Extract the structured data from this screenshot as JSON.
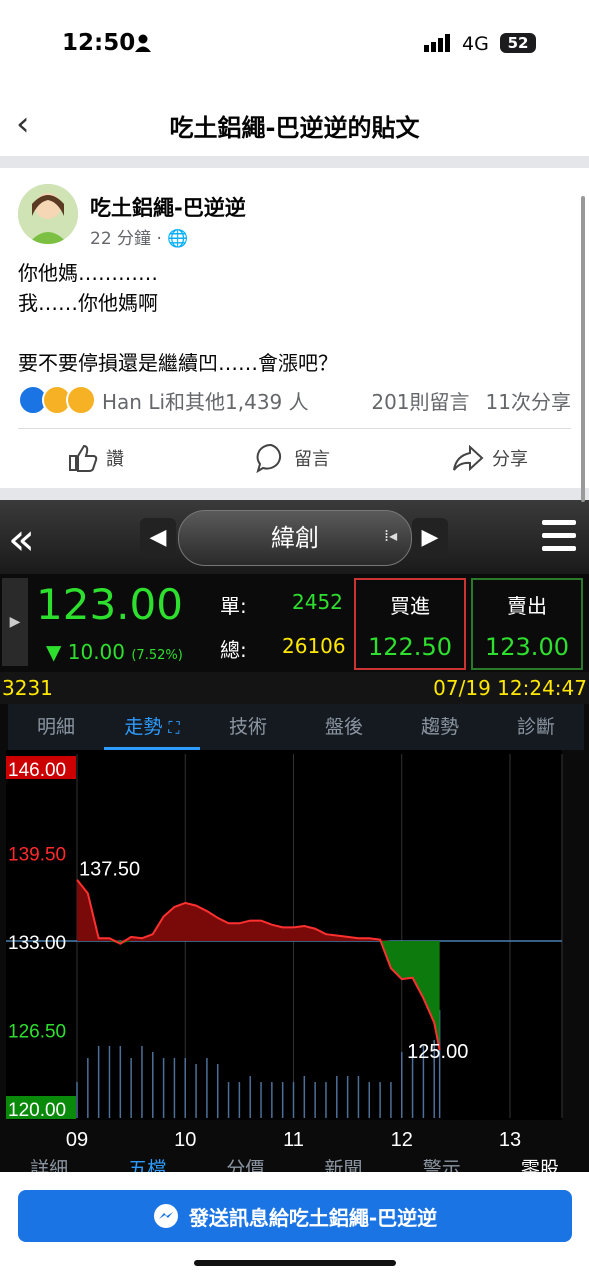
{
  "status_bar": {
    "time": "12:50",
    "network": "4G",
    "battery": "52"
  },
  "header": {
    "title": "吃土鋁繩-巴逆逆的貼文"
  },
  "post": {
    "author": "吃土鋁繩-巴逆逆",
    "time": "22 分鐘",
    "lines": [
      "你他媽…………",
      "我……你他媽啊",
      "",
      "要不要停損還是繼續凹……會漲吧？"
    ],
    "reaction_names": "Han Li和其他1,439 人",
    "comments": "201則留言",
    "shares": "11次分享",
    "actions": {
      "like": "讚",
      "comment": "留言",
      "share": "分享"
    }
  },
  "stock": {
    "name": "緯創",
    "price": "123.00",
    "change": "▼ 10.00",
    "change_pct": "(7.52%)",
    "single_label": "單:",
    "single_value": "2452",
    "total_label": "總:",
    "total_value": "26106",
    "buy_label": "買進",
    "buy_value": "122.50",
    "sell_label": "賣出",
    "sell_value": "123.00",
    "code": "3231",
    "datetime": "07/19 12:24:47",
    "tabs": [
      "明細",
      "走勢",
      "技術",
      "盤後",
      "趨勢",
      "診斷"
    ],
    "active_tab": 1,
    "bottom_tabs": [
      "詳細",
      "五檔",
      "分價",
      "新聞",
      "警示",
      "零股"
    ],
    "colors": {
      "up": "#ff2a2a",
      "down": "#2ee02e",
      "yellow": "#ffe800",
      "accent": "#2e9cff"
    }
  },
  "chart_data": {
    "type": "area",
    "y_ticks": [
      "146.00",
      "139.50",
      "133.00",
      "126.50",
      "120.00"
    ],
    "x_ticks": [
      "09",
      "10",
      "11",
      "12",
      "13"
    ],
    "ylim": [
      120,
      146
    ],
    "xlim": [
      9,
      13.5
    ],
    "reference": 133.0,
    "annotations": [
      "137.50",
      "125.00"
    ],
    "x": [
      9.0,
      9.1,
      9.2,
      9.3,
      9.4,
      9.5,
      9.6,
      9.7,
      9.8,
      9.9,
      10.0,
      10.1,
      10.2,
      10.3,
      10.4,
      10.5,
      10.6,
      10.7,
      10.8,
      10.9,
      11.0,
      11.1,
      11.2,
      11.3,
      11.4,
      11.5,
      11.6,
      11.7,
      11.8,
      11.9,
      12.0,
      12.1,
      12.2,
      12.3,
      12.35
    ],
    "values": [
      137.5,
      136.5,
      133.2,
      133.2,
      132.8,
      133.3,
      133.2,
      133.5,
      134.8,
      135.5,
      135.8,
      135.6,
      135.2,
      134.7,
      134.3,
      134.3,
      134.5,
      134.5,
      134.2,
      134.0,
      134.0,
      134.1,
      133.9,
      133.5,
      133.4,
      133.3,
      133.2,
      133.2,
      133.1,
      131.0,
      130.2,
      130.3,
      128.8,
      127.0,
      125.0
    ],
    "volume": [
      0.3,
      0.5,
      0.6,
      0.6,
      0.6,
      0.5,
      0.6,
      0.55,
      0.5,
      0.5,
      0.5,
      0.45,
      0.5,
      0.45,
      0.3,
      0.3,
      0.35,
      0.3,
      0.3,
      0.3,
      0.3,
      0.35,
      0.3,
      0.3,
      0.35,
      0.35,
      0.35,
      0.3,
      0.3,
      0.3,
      0.55,
      0.6,
      0.6,
      0.65,
      0.9
    ]
  },
  "message_button": {
    "label": "發送訊息給吃土鋁繩-巴逆逆"
  }
}
